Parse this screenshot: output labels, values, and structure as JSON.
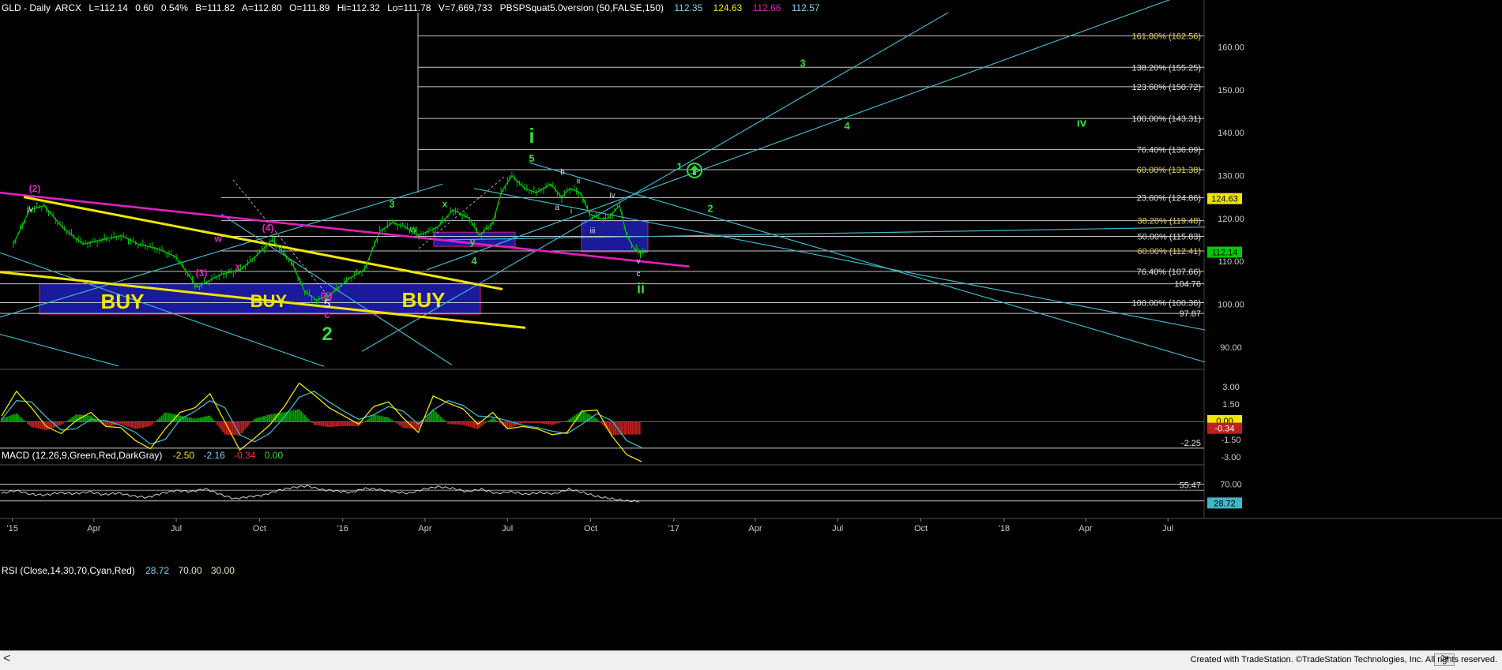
{
  "header": {
    "symbol": "GLD - Daily",
    "exchange": "ARCX",
    "last": "L=112.14",
    "change": "0.60",
    "change_pct": "0.54%",
    "bid": "B=111.82",
    "ask": "A=112.80",
    "open": "O=111.89",
    "high": "Hi=112.32",
    "low": "Lo=111.78",
    "volume": "V=7,669,733",
    "study": "PBSPSquat5.0version (50,FALSE,150)",
    "study_vals": [
      "112.35",
      "124.63",
      "112.66",
      "112.57"
    ]
  },
  "macd": {
    "title": "MACD (12,26,9,Green,Red,DarkGray)",
    "v1": "-2.50",
    "v2": "-2.16",
    "v3": "-0.34",
    "v4": "0.00"
  },
  "rsi": {
    "title": "RSI (Close,14,30,70,Cyan,Red)",
    "v1": "28.72",
    "v2": "70.00",
    "v3": "30.00"
  },
  "footer": {
    "left_arrow": "<",
    "right_arrow": ">",
    "credit": "Created with TradeStation. ©TradeStation Technologies, Inc. All rights reserved."
  },
  "colors": {
    "bg": "#000000",
    "grid": "#2a2a2a",
    "bar": "#00cc00",
    "cyan": "#3fb6c8",
    "yellow": "#f0e600",
    "magenta": "#e020c0",
    "green_label": "#33dd33",
    "buy_box": "#1a1a9a",
    "axis_text": "#cccccc"
  },
  "chart_data": [
    {
      "type": "line",
      "title": "GLD - Daily",
      "x_ticks": [
        "'15",
        "Apr",
        "Jul",
        "Oct",
        "'16",
        "Apr",
        "Jul",
        "Oct",
        "'17",
        "Apr",
        "Jul",
        "Oct",
        "'18",
        "Apr",
        "Jul"
      ],
      "y_ticks": [
        90,
        100,
        110,
        120,
        130,
        140,
        150,
        160
      ],
      "ylim": [
        85,
        168
      ],
      "grid": false,
      "series": [
        {
          "x": [
            "2015-01-02",
            "2015-01-20",
            "2015-02-05",
            "2015-02-25",
            "2015-03-20",
            "2015-04-10",
            "2015-05-01",
            "2015-05-20",
            "2015-06-10",
            "2015-07-01",
            "2015-07-24",
            "2015-08-20",
            "2015-09-10",
            "2015-10-01",
            "2015-10-15",
            "2015-11-05",
            "2015-11-20",
            "2015-12-03",
            "2015-12-17",
            "2016-01-08",
            "2016-01-25",
            "2016-02-11",
            "2016-02-25",
            "2016-03-10",
            "2016-03-25",
            "2016-04-15",
            "2016-05-02",
            "2016-05-20",
            "2016-05-31",
            "2016-06-15",
            "2016-06-24",
            "2016-07-06",
            "2016-07-20",
            "2016-08-02",
            "2016-08-18",
            "2016-08-30",
            "2016-09-08",
            "2016-09-20",
            "2016-09-30",
            "2016-10-10",
            "2016-10-20",
            "2016-11-02",
            "2016-11-10",
            "2016-11-18",
            "2016-11-25",
            "2016-12-02"
          ],
          "values": [
            114,
            122,
            123,
            118,
            114,
            115,
            116,
            114,
            113,
            111,
            104,
            107,
            108,
            112,
            115,
            110,
            103,
            101,
            102,
            106,
            108,
            117,
            119,
            118,
            116,
            118,
            122,
            120,
            116,
            119,
            126,
            130,
            127,
            126,
            128,
            125,
            127,
            126,
            121,
            120,
            120,
            123,
            116,
            113,
            112,
            112.14
          ]
        }
      ],
      "annotations": [
        {
          "text": "BUY"
        },
        {
          "text": "BUY"
        },
        {
          "text": "BUY"
        },
        {
          "text": "(2)"
        },
        {
          "text": "(3)"
        },
        {
          "text": "(4)"
        },
        {
          "text": "(5)"
        },
        {
          "text": "iv"
        },
        {
          "text": "w"
        },
        {
          "text": "x"
        },
        {
          "text": "y"
        },
        {
          "text": "x"
        },
        {
          "text": "w"
        },
        {
          "text": "5"
        },
        {
          "text": "c"
        },
        {
          "text": "2"
        },
        {
          "text": "3"
        },
        {
          "text": "4"
        },
        {
          "text": "5"
        },
        {
          "text": "i"
        },
        {
          "text": "1"
        },
        {
          "text": "2"
        },
        {
          "text": "3"
        },
        {
          "text": "4"
        },
        {
          "text": "iv"
        },
        {
          "text": "ii"
        },
        {
          "text": "a"
        },
        {
          "text": "b"
        },
        {
          "text": "i"
        },
        {
          "text": "ii"
        },
        {
          "text": "iii"
        },
        {
          "text": "iv"
        },
        {
          "text": "v"
        },
        {
          "text": "c"
        }
      ],
      "fib_levels": [
        {
          "label": "161.80% (162.56)",
          "value": 162.56
        },
        {
          "label": "138.20% (155.25)",
          "value": 155.25
        },
        {
          "label": "123.60% (150.72)",
          "value": 150.72
        },
        {
          "label": "100.00% (143.31)",
          "value": 143.31
        },
        {
          "label": "76.40% (136.09)",
          "value": 136.09
        },
        {
          "label": "60.00% (131.38)",
          "value": 131.38
        },
        {
          "label": "23.60% (124.86)",
          "value": 124.86
        },
        {
          "label": "38.20% (119.48)",
          "value": 119.48
        },
        {
          "label": "50.00% (115.83)",
          "value": 115.83
        },
        {
          "label": "60.00% (112.41)",
          "value": 112.41
        },
        {
          "label": "76.40% (107.66)",
          "value": 107.66
        },
        {
          "label": "104.76",
          "value": 104.76
        },
        {
          "label": "100.00% (100.36)",
          "value": 100.36
        },
        {
          "label": "97.87",
          "value": 97.87
        }
      ],
      "price_tags": [
        {
          "label": "124.63",
          "value": 124.63
        },
        {
          "label": "112.14",
          "value": 112.14
        }
      ]
    },
    {
      "type": "line",
      "title": "MACD (12,26,9,Green,Red,DarkGray)",
      "y_ticks": [
        3.0,
        1.5,
        0.0,
        -1.5,
        -3.0
      ],
      "y_tick_labels": [
        "3.00",
        "1.50",
        "0.00",
        "-1.50",
        "-3.00"
      ],
      "ylim": [
        -3.6,
        3.8
      ],
      "series": [
        {
          "name": "MACD",
          "values": [
            0.5,
            2.6,
            1.2,
            -0.4,
            -1.0,
            0.1,
            0.8,
            -0.4,
            -0.5,
            -1.6,
            -2.3,
            -0.6,
            0.8,
            1.2,
            2.4,
            0.0,
            -2.4,
            -1.4,
            -0.3,
            1.3,
            3.3,
            2.3,
            1.2,
            0.5,
            -0.2,
            1.3,
            1.7,
            0.3,
            -0.9,
            2.2,
            1.6,
            1.1,
            -0.2,
            0.8,
            -0.6,
            -0.4,
            -0.6,
            -1.1,
            -0.9,
            0.9,
            1.0,
            -1.2,
            -2.8,
            -3.4
          ]
        },
        {
          "name": "Signal",
          "values": [
            0.2,
            1.8,
            1.7,
            0.4,
            -0.7,
            -0.6,
            0.2,
            0.1,
            -0.3,
            -0.9,
            -1.9,
            -1.5,
            0.2,
            0.9,
            1.8,
            1.2,
            -1.1,
            -1.7,
            -1.0,
            0.4,
            2.1,
            2.6,
            1.7,
            0.9,
            0.2,
            0.6,
            1.3,
            0.9,
            -0.2,
            1.0,
            1.8,
            1.4,
            0.5,
            0.4,
            0.1,
            -0.3,
            -0.5,
            -0.8,
            -1.0,
            -0.2,
            0.7,
            0.1,
            -1.6,
            -2.2
          ]
        }
      ],
      "price_tags": [
        {
          "label": "-0.34",
          "value": -0.34
        },
        {
          "label": "-2.25",
          "value": -2.25
        }
      ]
    },
    {
      "type": "line",
      "title": "RSI (Close,14,30,70,Cyan,Red)",
      "y_ticks": [
        70,
        30
      ],
      "y_tick_labels": [
        "70.00",
        "30.00"
      ],
      "ylim": [
        20,
        90
      ],
      "series": [
        {
          "name": "RSI",
          "values": [
            48,
            55,
            46,
            44,
            50,
            47,
            52,
            45,
            49,
            42,
            38,
            48,
            55,
            52,
            59,
            46,
            35,
            40,
            44,
            55,
            62,
            66,
            57,
            54,
            50,
            60,
            57,
            52,
            48,
            58,
            64,
            60,
            52,
            58,
            48,
            52,
            46,
            50,
            47,
            58,
            50,
            40,
            35,
            30,
            28.72
          ]
        }
      ],
      "price_tags": [
        {
          "label": "55.47",
          "value": 55.47
        },
        {
          "label": "28.72",
          "value": 28.72
        }
      ]
    }
  ]
}
